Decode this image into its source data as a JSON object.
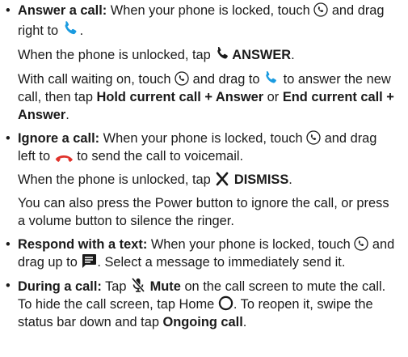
{
  "accent": "#1a9be0",
  "decline_color": "#e0322b",
  "icons": [
    "call-circle-icon",
    "phone-answer-icon",
    "phone-decline-icon",
    "close-x-icon",
    "message-icon",
    "mute-icon",
    "home-circle-icon"
  ],
  "bullet_char": "•",
  "answer": {
    "label": "Answer a call:",
    "p1_a": " When your phone is locked, touch ",
    "p1_b": " and drag right to ",
    "p1_c": ".",
    "p2_a": "When the phone is unlocked, tap ",
    "p2_btn": "ANSWER",
    "p2_c": ".",
    "p3_a": "With call waiting on, touch ",
    "p3_b": " and drag to ",
    "p3_c": " to answer the new call, then tap ",
    "p3_btn1": "Hold current call + Answer",
    "p3_or": " or ",
    "p3_btn2": "End current call + Answer",
    "p3_d": "."
  },
  "ignore": {
    "label": "Ignore a call:",
    "p1_a": " When your phone is locked, touch ",
    "p1_b": " and drag left to ",
    "p1_c": " to send the call to voicemail.",
    "p2_a": "When the phone is unlocked, tap ",
    "p2_btn": "DISMISS",
    "p2_c": ".",
    "p3": "You can also press the Power button to ignore the call, or press a volume button to silence the ringer."
  },
  "respond": {
    "label": "Respond with a text:",
    "p1_a": " When your phone is locked, touch ",
    "p1_b": " and drag up to ",
    "p1_c": ". Select a message to immediately send it."
  },
  "during": {
    "label": "During a call:",
    "p1_a": " Tap ",
    "p1_mute": "Mute",
    "p1_b": " on the call screen to mute the call. To hide the call screen, tap Home ",
    "p1_c": ". To reopen it, swipe the status bar down and tap ",
    "p1_btn": "Ongoing call",
    "p1_d": "."
  }
}
